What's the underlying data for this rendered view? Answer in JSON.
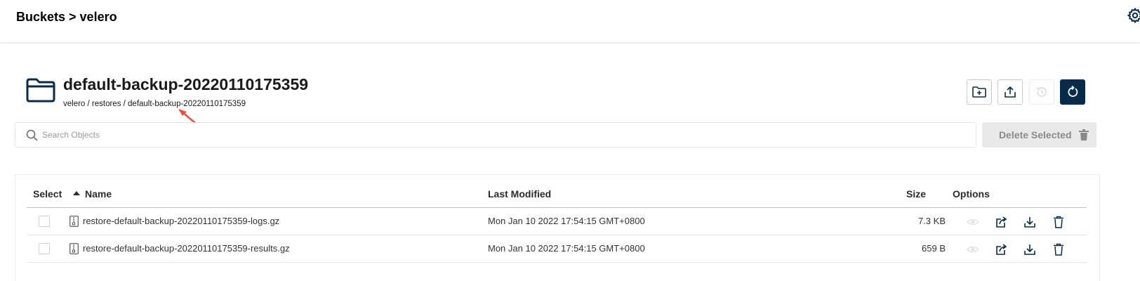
{
  "header": {
    "breadcrumb": "Buckets > velero",
    "settings_icon": "gear-icon"
  },
  "object": {
    "title": "default-backup-20220110175359",
    "path": "velero / restores / default-backup-20220110175359",
    "icon": "folder-icon"
  },
  "toolbar": {
    "create_folder_icon": "folder-plus-icon",
    "upload_icon": "upload-icon",
    "rewind_icon": "rewind-history-icon",
    "refresh_icon": "refresh-icon"
  },
  "search": {
    "placeholder": "Search Objects",
    "value": ""
  },
  "delete_selected": {
    "label": "Delete Selected",
    "icon": "trash-icon"
  },
  "table": {
    "columns": {
      "select": "Select",
      "name": "Name",
      "last_modified": "Last Modified",
      "size": "Size",
      "options": "Options"
    },
    "sort_indicator": "sort-ascending-icon",
    "rows": [
      {
        "name": "restore-default-backup-20220110175359-logs.gz",
        "last_modified": "Mon Jan 10 2022 17:54:15 GMT+0800",
        "size": "7.3 KB"
      },
      {
        "name": "restore-default-backup-20220110175359-results.gz",
        "last_modified": "Mon Jan 10 2022 17:54:15 GMT+0800",
        "size": "659 B"
      }
    ]
  },
  "colors": {
    "primary": "#082b4b",
    "annotation_arrow": "#e8503a"
  }
}
